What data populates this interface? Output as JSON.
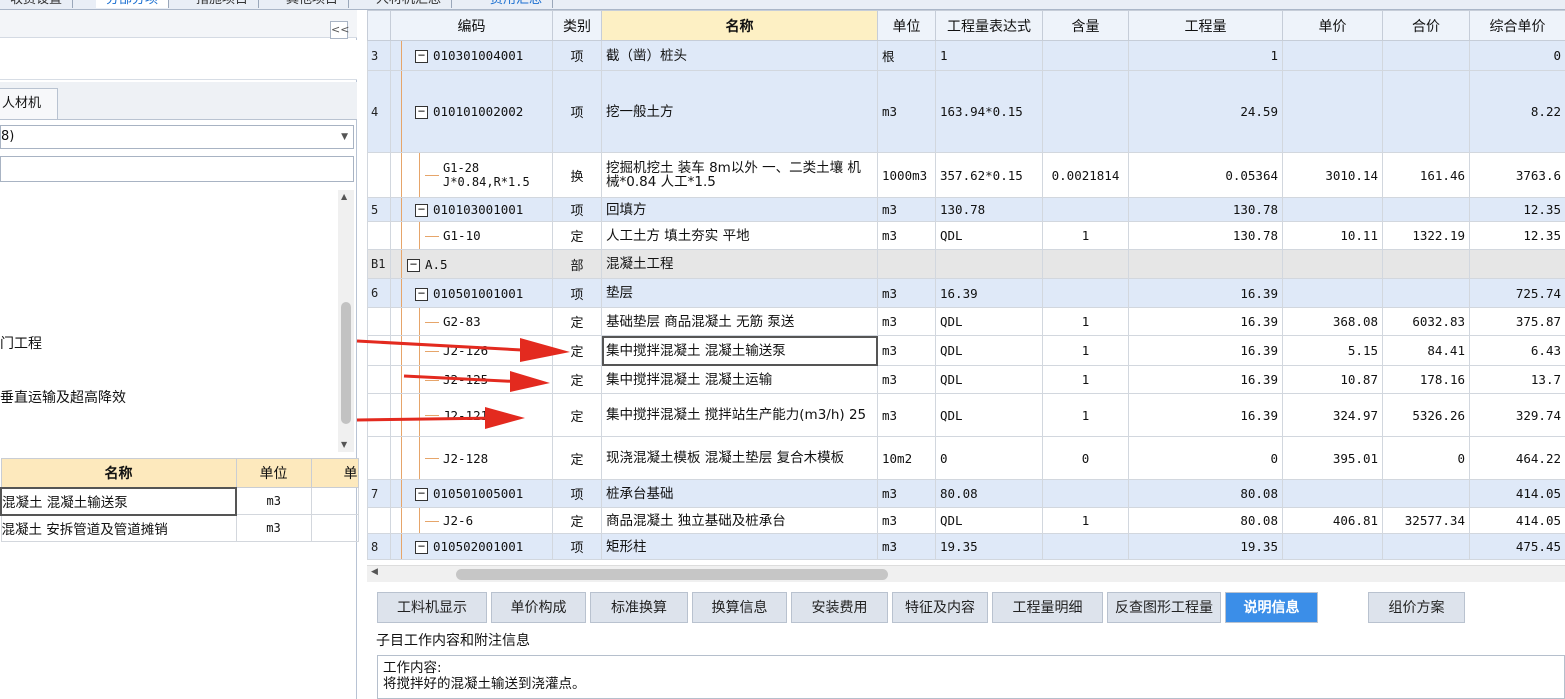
{
  "top_tabs": [
    "收费设置",
    "分部分项",
    "措施项目",
    "其他项目",
    "人材机汇总",
    "费用汇总"
  ],
  "left": {
    "collapse_label": "<<",
    "tab_label": "人材机",
    "select_value": "8)",
    "tree_items": [
      "门工程",
      "垂直运输及超高降效"
    ],
    "table": {
      "headers": [
        "名称",
        "单位",
        "单"
      ],
      "rows": [
        {
          "name": "混凝土 混凝土输送泵",
          "unit": "m3"
        },
        {
          "name": "混凝土 安拆管道及管道摊销",
          "unit": "m3"
        }
      ]
    }
  },
  "grid": {
    "headers": [
      "",
      "编码",
      "类别",
      "名称",
      "单位",
      "工程量表达式",
      "含量",
      "工程量",
      "单价",
      "合价",
      "综合单价"
    ],
    "rows": [
      {
        "rn": "3",
        "code": "010301004001",
        "type": "项",
        "name": "截（凿）桩头",
        "unit": "根",
        "expr": "1",
        "content": "",
        "qty": "1",
        "price": "",
        "total": "",
        "comp": "0"
      },
      {
        "rn": "4",
        "code": "010101002002",
        "type": "项",
        "name": "挖一般土方",
        "unit": "m3",
        "expr": "163.94*0.15",
        "content": "",
        "qty": "24.59",
        "price": "",
        "total": "",
        "comp": "8.22"
      },
      {
        "rn": "",
        "code": "G1-28\nJ*0.84,R*1.5",
        "type": "换",
        "name": "挖掘机挖土 装车 8m以外 一、二类土壤 机械*0.84 人工*1.5",
        "unit": "1000m3",
        "expr": "357.62*0.15",
        "content": "0.0021814",
        "qty": "0.05364",
        "price": "3010.14",
        "total": "161.46",
        "comp": "3763.6"
      },
      {
        "rn": "5",
        "code": "010103001001",
        "type": "项",
        "name": "回填方",
        "unit": "m3",
        "expr": "130.78",
        "content": "",
        "qty": "130.78",
        "price": "",
        "total": "",
        "comp": "12.35"
      },
      {
        "rn": "",
        "code": "G1-10",
        "type": "定",
        "name": "人工土方 填土夯实 平地",
        "unit": "m3",
        "expr": "QDL",
        "content": "1",
        "qty": "130.78",
        "price": "10.11",
        "total": "1322.19",
        "comp": "12.35"
      },
      {
        "rn": "B1",
        "code": "A.5",
        "type": "部",
        "name": "混凝土工程",
        "unit": "",
        "expr": "",
        "content": "",
        "qty": "",
        "price": "",
        "total": "",
        "comp": ""
      },
      {
        "rn": "6",
        "code": "010501001001",
        "type": "项",
        "name": "垫层",
        "unit": "m3",
        "expr": "16.39",
        "content": "",
        "qty": "16.39",
        "price": "",
        "total": "",
        "comp": "725.74"
      },
      {
        "rn": "",
        "code": "G2-83",
        "type": "定",
        "name": "基础垫层 商品混凝土 无筋 泵送",
        "unit": "m3",
        "expr": "QDL",
        "content": "1",
        "qty": "16.39",
        "price": "368.08",
        "total": "6032.83",
        "comp": "375.87"
      },
      {
        "rn": "",
        "code": "J2-126",
        "type": "定",
        "name": "集中搅拌混凝土 混凝土输送泵",
        "unit": "m3",
        "expr": "QDL",
        "content": "1",
        "qty": "16.39",
        "price": "5.15",
        "total": "84.41",
        "comp": "6.43"
      },
      {
        "rn": "",
        "code": "J2-125",
        "type": "定",
        "name": "集中搅拌混凝土 混凝土运输",
        "unit": "m3",
        "expr": "QDL",
        "content": "1",
        "qty": "16.39",
        "price": "10.87",
        "total": "178.16",
        "comp": "13.7"
      },
      {
        "rn": "",
        "code": "J2-121",
        "type": "定",
        "name": "集中搅拌混凝土 搅拌站生产能力(m3/h) 25",
        "unit": "m3",
        "expr": "QDL",
        "content": "1",
        "qty": "16.39",
        "price": "324.97",
        "total": "5326.26",
        "comp": "329.74"
      },
      {
        "rn": "",
        "code": "J2-128",
        "type": "定",
        "name": "现浇混凝土模板 混凝土垫层 复合木模板",
        "unit": "10m2",
        "expr": "0",
        "content": "0",
        "qty": "0",
        "price": "395.01",
        "total": "0",
        "comp": "464.22"
      },
      {
        "rn": "7",
        "code": "010501005001",
        "type": "项",
        "name": "桩承台基础",
        "unit": "m3",
        "expr": "80.08",
        "content": "",
        "qty": "80.08",
        "price": "",
        "total": "",
        "comp": "414.05"
      },
      {
        "rn": "",
        "code": "J2-6",
        "type": "定",
        "name": "商品混凝土 独立基础及桩承台",
        "unit": "m3",
        "expr": "QDL",
        "content": "1",
        "qty": "80.08",
        "price": "406.81",
        "total": "32577.34",
        "comp": "414.05"
      },
      {
        "rn": "8",
        "code": "010502001001",
        "type": "项",
        "name": "矩形柱",
        "unit": "m3",
        "expr": "19.35",
        "content": "",
        "qty": "19.35",
        "price": "",
        "total": "",
        "comp": "475.45"
      }
    ]
  },
  "bottom_tabs": [
    "工料机显示",
    "单价构成",
    "标准换算",
    "换算信息",
    "安装费用",
    "特征及内容",
    "工程量明细",
    "反查图形工程量",
    "说明信息",
    "组价方案"
  ],
  "desc": {
    "title": "子目工作内容和附注信息",
    "line1": "工作内容:",
    "line2": "将搅拌好的混凝土输送到浇灌点。"
  },
  "colors": {
    "accent": "#3b8ee8",
    "arrow": "#e32a1f",
    "row_xiang": "#dfe9f8",
    "header_hl": "#fdf0c4"
  }
}
